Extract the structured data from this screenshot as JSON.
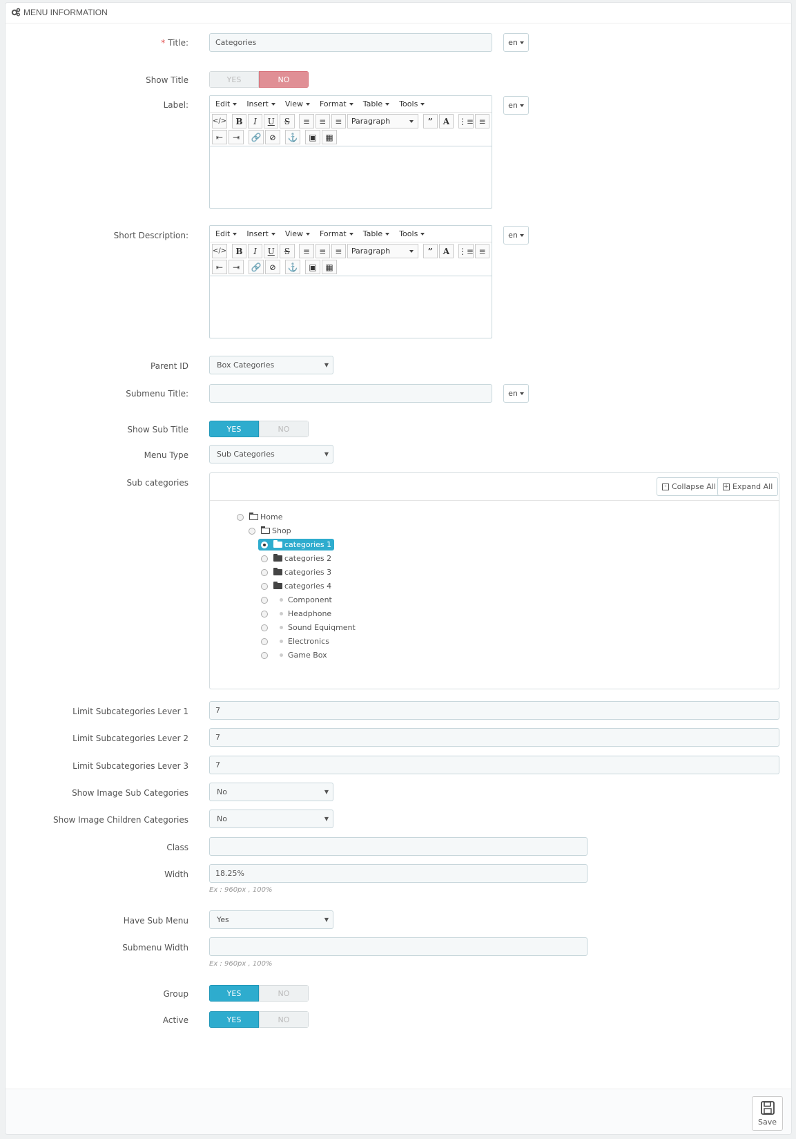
{
  "panel": {
    "title": "MENU INFORMATION",
    "icon": "cogs-icon"
  },
  "fields": {
    "title": {
      "label": "Title:",
      "required_mark": "*",
      "value": "Categories",
      "lang": "en"
    },
    "show_title": {
      "label": "Show Title",
      "yes": "YES",
      "no": "NO",
      "selected": "NO"
    },
    "label": {
      "label": "Label:",
      "lang": "en"
    },
    "short_description": {
      "label": "Short Description:",
      "lang": "en"
    },
    "parent_id": {
      "label": "Parent ID",
      "value": "Box Categories"
    },
    "submenu_title": {
      "label": "Submenu Title:",
      "value": "",
      "lang": "en"
    },
    "show_sub_title": {
      "label": "Show Sub Title",
      "yes": "YES",
      "no": "NO",
      "selected": "YES"
    },
    "menu_type": {
      "label": "Menu Type",
      "value": "Sub Categories"
    },
    "sub_categories": {
      "label": "Sub categories"
    },
    "limit1": {
      "label": "Limit Subcategories Lever 1",
      "value": "7"
    },
    "limit2": {
      "label": "Limit Subcategories Lever 2",
      "value": "7"
    },
    "limit3": {
      "label": "Limit Subcategories Lever 3",
      "value": "7"
    },
    "show_image_sub": {
      "label": "Show Image Sub Categories",
      "value": "No"
    },
    "show_image_children": {
      "label": "Show Image Children Categories",
      "value": "No"
    },
    "class": {
      "label": "Class",
      "value": ""
    },
    "width": {
      "label": "Width",
      "value": "18.25%",
      "hint": "Ex : 960px , 100%"
    },
    "have_sub_menu": {
      "label": "Have Sub Menu",
      "value": "Yes"
    },
    "submenu_width": {
      "label": "Submenu Width",
      "value": "",
      "hint": "Ex : 960px , 100%"
    },
    "group": {
      "label": "Group",
      "yes": "YES",
      "no": "NO",
      "selected": "YES"
    },
    "active": {
      "label": "Active",
      "yes": "YES",
      "no": "NO",
      "selected": "YES"
    }
  },
  "editor": {
    "menus": [
      "Edit",
      "Insert",
      "View",
      "Format",
      "Table",
      "Tools"
    ],
    "block_format": "Paragraph"
  },
  "tree": {
    "collapse_label": "Collapse All",
    "expand_label": "Expand All",
    "nodes": [
      "Home",
      "Shop",
      "categories 1",
      "categories 2",
      "categories 3",
      "categories 4",
      "Component",
      "Headphone",
      "Sound Equiqment",
      "Electronics",
      "Game Box"
    ],
    "selected": "categories 1"
  },
  "footer": {
    "save_label": "Save"
  },
  "colors": {
    "accent": "#2eacce",
    "no_active": "#e08f95"
  }
}
